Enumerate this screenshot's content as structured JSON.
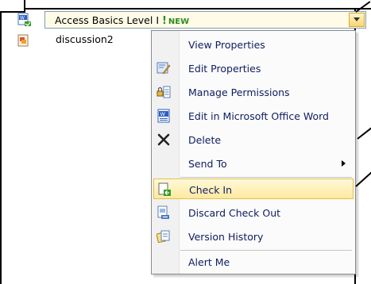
{
  "rows": [
    {
      "icon": "word-document-checked-out-icon",
      "title": "Access Basics Level I",
      "badge": "NEW"
    },
    {
      "icon": "discussion-item-icon",
      "title": "discussion2"
    }
  ],
  "menu": {
    "items": [
      {
        "label": "View Properties",
        "icon": ""
      },
      {
        "label": "Edit Properties",
        "icon": "edit-properties-icon"
      },
      {
        "label": "Manage Permissions",
        "icon": "manage-permissions-icon"
      },
      {
        "label": "Edit in Microsoft Office Word",
        "icon": "word-icon"
      },
      {
        "label": "Delete",
        "icon": "delete-x-icon"
      },
      {
        "label": "Send To",
        "icon": ""
      },
      {
        "label": "Check In",
        "icon": "check-in-icon"
      },
      {
        "label": "Discard Check Out",
        "icon": "discard-check-out-icon"
      },
      {
        "label": "Version History",
        "icon": "version-history-icon"
      },
      {
        "label": "Alert Me",
        "icon": ""
      }
    ]
  },
  "colors": {
    "menu_text": "#0f1c60",
    "highlight": "#fde99e",
    "new_badge": "#2e8b22"
  }
}
